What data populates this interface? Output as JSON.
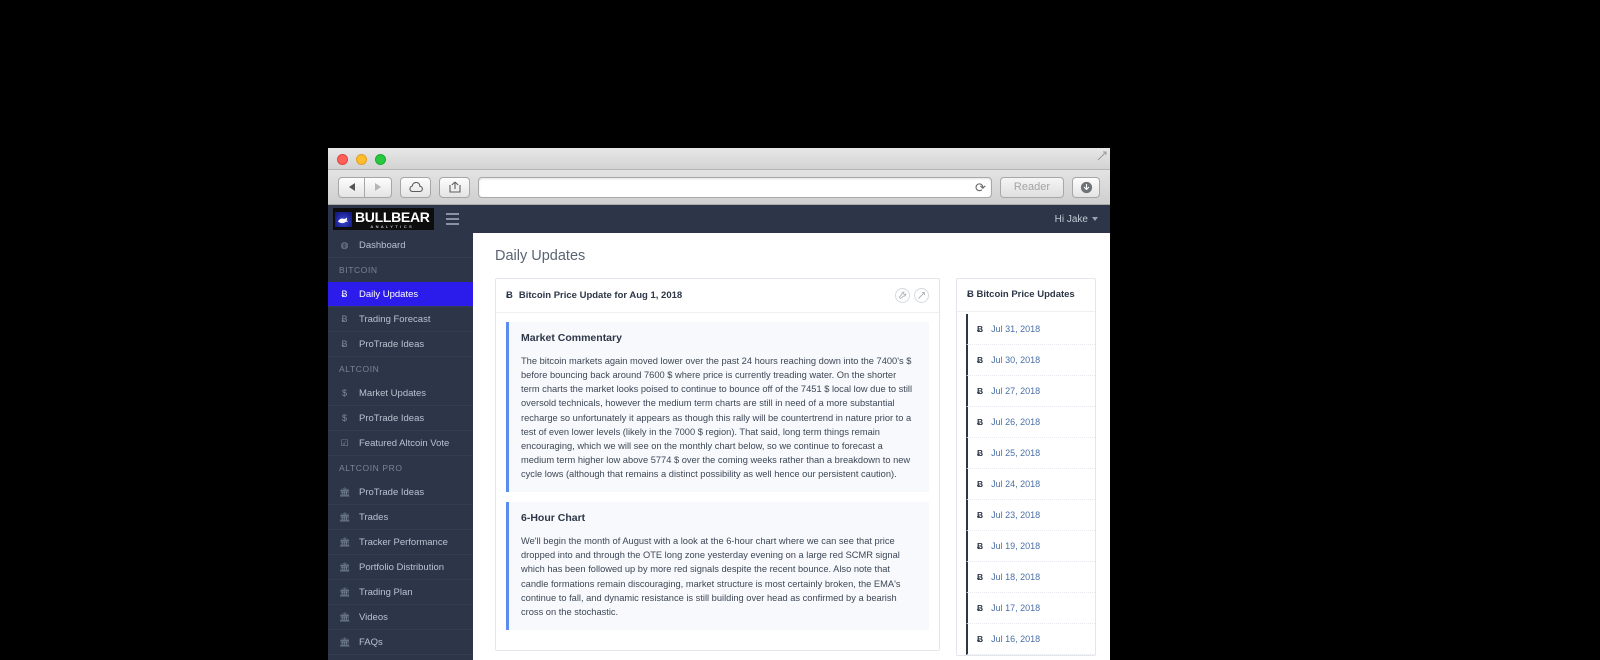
{
  "browser": {
    "traffic_lights": [
      "close",
      "minimize",
      "maximize"
    ],
    "back_label": "◀",
    "forward_label": "▶",
    "icloud_label": "icloud",
    "share_label": "share",
    "url_value": "",
    "url_placeholder": "",
    "reload_label": "⟳",
    "reader_label": "Reader",
    "download_label": "download"
  },
  "topbar": {
    "logo_main": "BULLBEAR",
    "logo_sub": "ANALYTICS",
    "menu_toggle": "menu",
    "user_greeting": "Hi Jake"
  },
  "sidebar": {
    "items": [
      {
        "type": "item",
        "label": "Dashboard",
        "icon": "dashboard-icon",
        "glyph": "◍",
        "active": false
      },
      {
        "type": "head",
        "label": "BITCOIN"
      },
      {
        "type": "item",
        "label": "Daily Updates",
        "icon": "bitcoin-icon",
        "glyph": "Ƀ",
        "active": true
      },
      {
        "type": "item",
        "label": "Trading Forecast",
        "icon": "bitcoin-icon",
        "glyph": "Ƀ",
        "active": false
      },
      {
        "type": "item",
        "label": "ProTrade Ideas",
        "icon": "bitcoin-icon",
        "glyph": "Ƀ",
        "active": false
      },
      {
        "type": "head",
        "label": "ALTCOIN"
      },
      {
        "type": "item",
        "label": "Market Updates",
        "icon": "dollar-icon",
        "glyph": "$",
        "active": false
      },
      {
        "type": "item",
        "label": "ProTrade Ideas",
        "icon": "dollar-icon",
        "glyph": "$",
        "active": false
      },
      {
        "type": "item",
        "label": "Featured Altcoin Vote",
        "icon": "checkbox-icon",
        "glyph": "☑",
        "active": false
      },
      {
        "type": "head",
        "label": "ALTCOIN PRO"
      },
      {
        "type": "item",
        "label": "ProTrade Ideas",
        "icon": "bank-icon",
        "glyph": "🏛",
        "active": false
      },
      {
        "type": "item",
        "label": "Trades",
        "icon": "bank-icon",
        "glyph": "🏛",
        "active": false
      },
      {
        "type": "item",
        "label": "Tracker Performance",
        "icon": "bank-icon",
        "glyph": "🏛",
        "active": false
      },
      {
        "type": "item",
        "label": "Portfolio Distribution",
        "icon": "bank-icon",
        "glyph": "🏛",
        "active": false
      },
      {
        "type": "item",
        "label": "Trading Plan",
        "icon": "bank-icon",
        "glyph": "🏛",
        "active": false
      },
      {
        "type": "item",
        "label": "Videos",
        "icon": "bank-icon",
        "glyph": "🏛",
        "active": false
      },
      {
        "type": "item",
        "label": "FAQs",
        "icon": "bank-icon",
        "glyph": "🏛",
        "active": false
      }
    ]
  },
  "main": {
    "page_title": "Daily Updates",
    "card": {
      "title_icon": "Ƀ",
      "title": "Bitcoin Price Update for Aug 1, 2018",
      "action_wrench": "wrench-icon",
      "action_expand": "expand-icon",
      "sections": [
        {
          "heading": "Market Commentary",
          "text": "The bitcoin markets again moved lower over the past 24 hours reaching down into the 7400's $ before bouncing back around 7600 $ where price is currently treading water. On the shorter term charts the market looks poised to continue to bounce off of the 7451 $ local low due to still oversold technicals, however the medium term charts are still in need of a more substantial recharge so unfortunately it appears as though this rally will be countertrend in nature prior to a test of even lower levels (likely in the 7000 $ region). That said, long term things remain encouraging, which we will see on the monthly chart below, so we continue to forecast a medium term higher low above 5774 $ over the coming weeks rather than a breakdown to new cycle lows (although that remains a distinct possibility as well hence our persistent caution)."
        },
        {
          "heading": "6-Hour Chart",
          "text": "We'll begin the month of August with a look at the 6-hour chart where we can see that price dropped into and through the OTE long zone yesterday evening on a large red SCMR signal which has been followed up by more red signals despite the recent bounce. Also note that candle formations remain discouraging, market structure is most certainly broken, the EMA's continue to fall, and dynamic resistance is still building over head as confirmed by a bearish cross on the stochastic."
        }
      ]
    }
  },
  "side_panel": {
    "title": "Bitcoin Price Updates",
    "title_icon": "Ƀ",
    "dates": [
      "Jul 31, 2018",
      "Jul 30, 2018",
      "Jul 27, 2018",
      "Jul 26, 2018",
      "Jul 25, 2018",
      "Jul 24, 2018",
      "Jul 23, 2018",
      "Jul 19, 2018",
      "Jul 18, 2018",
      "Jul 17, 2018",
      "Jul 16, 2018"
    ]
  },
  "colors": {
    "sidebar_bg": "#2c3648",
    "active_nav": "#2b1ceb",
    "panel_accent": "#5b8def",
    "link": "#4a6fa5"
  }
}
